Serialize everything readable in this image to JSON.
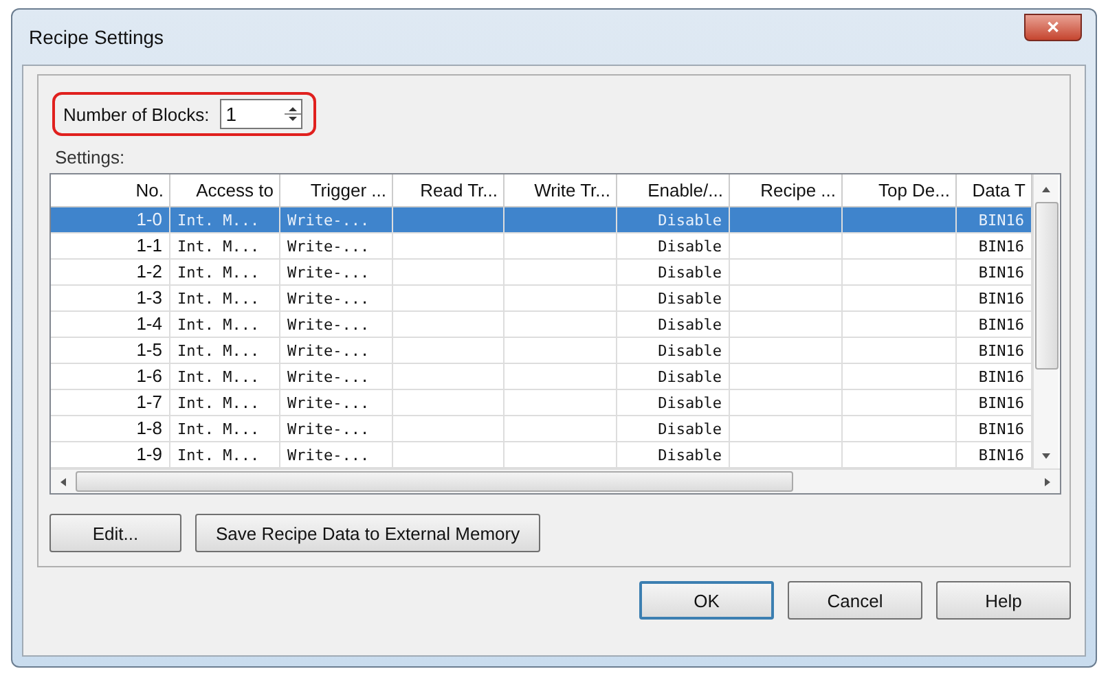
{
  "window": {
    "title": "Recipe Settings",
    "close": "✕"
  },
  "number_of_blocks": {
    "label": "Number of Blocks:",
    "value": "1",
    "highlighted": true
  },
  "settings": {
    "label": "Settings:",
    "columns": [
      "No.",
      "Access to",
      "Trigger ...",
      "Read Tr...",
      "Write Tr...",
      "Enable/...",
      "Recipe ...",
      "Top De...",
      "Data T"
    ],
    "rows": [
      {
        "selected": true,
        "cells": [
          "1-0",
          "Int. M...",
          "Write-...",
          "",
          "",
          "Disable",
          "",
          "",
          "BIN16"
        ]
      },
      {
        "selected": false,
        "cells": [
          "1-1",
          "Int. M...",
          "Write-...",
          "",
          "",
          "Disable",
          "",
          "",
          "BIN16"
        ]
      },
      {
        "selected": false,
        "cells": [
          "1-2",
          "Int. M...",
          "Write-...",
          "",
          "",
          "Disable",
          "",
          "",
          "BIN16"
        ]
      },
      {
        "selected": false,
        "cells": [
          "1-3",
          "Int. M...",
          "Write-...",
          "",
          "",
          "Disable",
          "",
          "",
          "BIN16"
        ]
      },
      {
        "selected": false,
        "cells": [
          "1-4",
          "Int. M...",
          "Write-...",
          "",
          "",
          "Disable",
          "",
          "",
          "BIN16"
        ]
      },
      {
        "selected": false,
        "cells": [
          "1-5",
          "Int. M...",
          "Write-...",
          "",
          "",
          "Disable",
          "",
          "",
          "BIN16"
        ]
      },
      {
        "selected": false,
        "cells": [
          "1-6",
          "Int. M...",
          "Write-...",
          "",
          "",
          "Disable",
          "",
          "",
          "BIN16"
        ]
      },
      {
        "selected": false,
        "cells": [
          "1-7",
          "Int. M...",
          "Write-...",
          "",
          "",
          "Disable",
          "",
          "",
          "BIN16"
        ]
      },
      {
        "selected": false,
        "cells": [
          "1-8",
          "Int. M...",
          "Write-...",
          "",
          "",
          "Disable",
          "",
          "",
          "BIN16"
        ]
      },
      {
        "selected": false,
        "cells": [
          "1-9",
          "Int. M...",
          "Write-...",
          "",
          "",
          "Disable",
          "",
          "",
          "BIN16"
        ]
      }
    ]
  },
  "panel_buttons": [
    "Edit...",
    "Save Recipe Data to External Memory"
  ],
  "buttons": [
    "OK",
    "Cancel",
    "Help"
  ]
}
